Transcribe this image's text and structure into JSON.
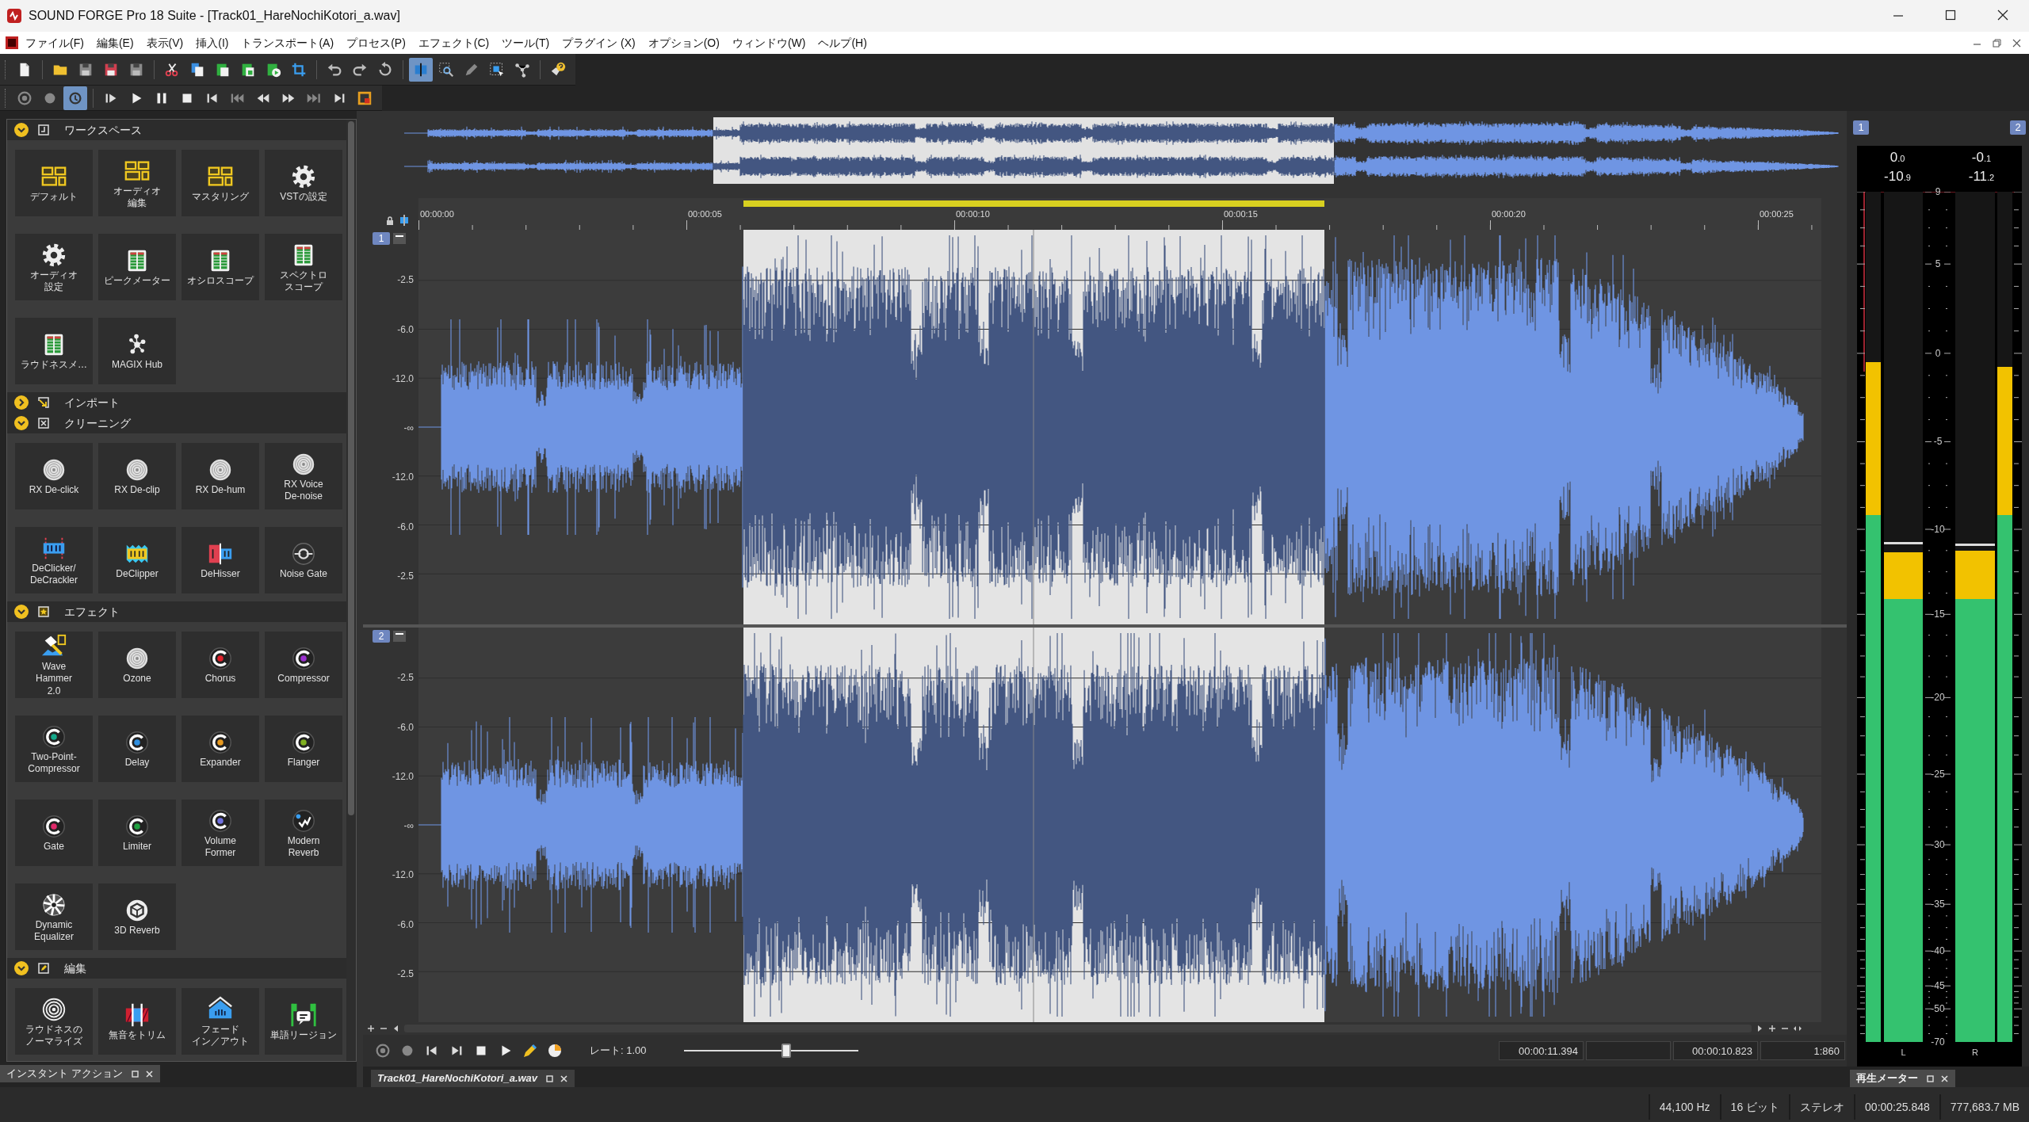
{
  "window": {
    "title": "SOUND FORGE Pro 18 Suite - [Track01_HareNochiKotori_a.wav]"
  },
  "menu": [
    "ファイル(F)",
    "編集(E)",
    "表示(V)",
    "挿入(I)",
    "トランスポート(A)",
    "プロセス(P)",
    "エフェクト(C)",
    "ツール(T)",
    "プラグイン (X)",
    "オプション(O)",
    "ウィンドウ(W)",
    "ヘルプ(H)"
  ],
  "toolbars": [
    [
      {
        "kind": "new",
        "pressed": false
      },
      {
        "kind": "separator"
      },
      {
        "kind": "open",
        "pressed": false
      },
      {
        "kind": "save",
        "pressed": false
      },
      {
        "kind": "save-as",
        "pressed": false
      },
      {
        "kind": "save-all",
        "pressed": false
      },
      {
        "kind": "separator"
      },
      {
        "kind": "cut",
        "pressed": false
      },
      {
        "kind": "copy",
        "pressed": false
      },
      {
        "kind": "paste",
        "pressed": false
      },
      {
        "kind": "paste-mix",
        "pressed": false
      },
      {
        "kind": "paste-new",
        "pressed": false
      },
      {
        "kind": "crop",
        "pressed": false
      },
      {
        "kind": "separator"
      },
      {
        "kind": "undo",
        "pressed": false
      },
      {
        "kind": "redo",
        "pressed": false
      },
      {
        "kind": "repeat",
        "pressed": false
      },
      {
        "kind": "separator"
      },
      {
        "kind": "edit-tool",
        "pressed": true
      },
      {
        "kind": "magnify",
        "pressed": false
      },
      {
        "kind": "pencil",
        "pressed": false
      },
      {
        "kind": "event",
        "pressed": false
      },
      {
        "kind": "nodes",
        "pressed": false
      },
      {
        "kind": "separator"
      },
      {
        "kind": "help",
        "pressed": false
      }
    ],
    [
      {
        "kind": "record",
        "pressed": false
      },
      {
        "kind": "circle",
        "pressed": false
      },
      {
        "kind": "loop",
        "pressed": true
      },
      {
        "kind": "separator"
      },
      {
        "kind": "play-from",
        "pressed": false
      },
      {
        "kind": "play",
        "pressed": false
      },
      {
        "kind": "pause",
        "pressed": false
      },
      {
        "kind": "stop",
        "pressed": false
      },
      {
        "kind": "skip-start",
        "pressed": false
      },
      {
        "kind": "prev-marker",
        "pressed": false
      },
      {
        "kind": "rewind",
        "pressed": false
      },
      {
        "kind": "forward",
        "pressed": false
      },
      {
        "kind": "next-marker",
        "pressed": false
      },
      {
        "kind": "skip-end",
        "pressed": false
      },
      {
        "kind": "sync",
        "pressed": false
      }
    ]
  ],
  "sections": [
    {
      "title": "ワークスペース",
      "kind": "dock",
      "expanded": true,
      "items": [
        {
          "lines": [
            "デフォルト"
          ],
          "kind": "layout"
        },
        {
          "lines": [
            "オーディオ",
            "編集"
          ],
          "kind": "layout"
        },
        {
          "lines": [
            "マスタリング"
          ],
          "kind": "layout"
        },
        {
          "lines": [
            "VSTの設定"
          ],
          "kind": "gear"
        },
        {
          "lines": [
            "オーディオ",
            "設定"
          ],
          "kind": "gear"
        },
        {
          "lines": [
            "ピークメーター"
          ],
          "kind": "meter"
        },
        {
          "lines": [
            "オシロスコープ"
          ],
          "kind": "meter"
        },
        {
          "lines": [
            "スペクトロ",
            "スコープ"
          ],
          "kind": "meter"
        },
        {
          "lines": [
            "ラウドネスメ…"
          ],
          "kind": "meter"
        },
        {
          "lines": [
            "MAGIX Hub"
          ],
          "kind": "hub"
        }
      ]
    },
    {
      "title": "インポート",
      "kind": "import",
      "expanded": false
    },
    {
      "title": "クリーニング",
      "kind": "cross",
      "expanded": true,
      "items": [
        {
          "lines": [
            "RX De-click"
          ],
          "kind": "disc"
        },
        {
          "lines": [
            "RX De-clip"
          ],
          "kind": "disc"
        },
        {
          "lines": [
            "RX De-hum"
          ],
          "kind": "disc"
        },
        {
          "lines": [
            "RX Voice",
            "De-noise"
          ],
          "kind": "disc"
        },
        {
          "lines": [
            "DeClicker/",
            "DeCrackler"
          ],
          "kind": "declick"
        },
        {
          "lines": [
            "DeClipper"
          ],
          "kind": "declip"
        },
        {
          "lines": [
            "DeHisser"
          ],
          "kind": "dehiss"
        },
        {
          "lines": [
            "Noise Gate"
          ],
          "kind": "target"
        }
      ]
    },
    {
      "title": "エフェクト",
      "kind": "star",
      "expanded": true,
      "items": [
        {
          "lines": [
            "Wave",
            "Hammer",
            "2.0"
          ],
          "kind": "hammer"
        },
        {
          "lines": [
            "Ozone"
          ],
          "kind": "disc"
        },
        {
          "lines": [
            "Chorus"
          ],
          "kind": "dial",
          "color": "#e0202a"
        },
        {
          "lines": [
            "Compressor"
          ],
          "kind": "dial",
          "color": "#9b30d0"
        },
        {
          "lines": [
            "Two-Point-",
            "Compressor"
          ],
          "kind": "dial",
          "color": "#14a88a"
        },
        {
          "lines": [
            "Delay"
          ],
          "kind": "dial",
          "color": "#2f8fe0"
        },
        {
          "lines": [
            "Expander"
          ],
          "kind": "dial",
          "color": "#e89a20"
        },
        {
          "lines": [
            "Flanger"
          ],
          "kind": "dial",
          "color": "#7fb020"
        },
        {
          "lines": [
            "Gate"
          ],
          "kind": "dial",
          "color": "#e02a6a"
        },
        {
          "lines": [
            "Limiter"
          ],
          "kind": "dial",
          "color": "#20a040"
        },
        {
          "lines": [
            "Volume",
            "Former"
          ],
          "kind": "dial",
          "color": "#7070e0"
        },
        {
          "lines": [
            "Modern",
            "Reverb"
          ],
          "kind": "reverb"
        },
        {
          "lines": [
            "Dynamic",
            "Equalizer"
          ],
          "kind": "burst"
        },
        {
          "lines": [
            "3D Reverb"
          ],
          "kind": "sphere"
        }
      ]
    },
    {
      "title": "編集",
      "kind": "pencil",
      "expanded": true,
      "items": [
        {
          "lines": [
            "ラウドネスの",
            "ノーマライズ"
          ],
          "kind": "rings"
        },
        {
          "lines": [
            "無音をトリム"
          ],
          "kind": "trim"
        },
        {
          "lines": [
            "フェード",
            "イン／アウト"
          ],
          "kind": "fade"
        },
        {
          "lines": [
            "単語リージョン"
          ],
          "kind": "region"
        }
      ]
    }
  ],
  "instant_action_tab": "インスタント アクション",
  "ruler": [
    "00:00:00",
    "00:00:05",
    "00:00:10",
    "00:00:15",
    "00:00:20",
    "00:00:25"
  ],
  "tracks": [
    {
      "number": "1",
      "scale": [
        "-2.5",
        "-6.0",
        "-12.0",
        "-∞",
        "-12.0",
        "-6.0",
        "-2.5"
      ]
    },
    {
      "number": "2",
      "scale": [
        "-2.5",
        "-6.0",
        "-12.0",
        "-∞",
        "-12.0",
        "-6.0",
        "-2.5"
      ]
    }
  ],
  "transport": {
    "rate": "レート: 1.00",
    "rate_slider": {
      "level": 0.59
    },
    "fields": [
      "00:00:11.394",
      "00:00:10.823",
      "1:860"
    ]
  },
  "file_tab": "Track01_HareNochiKotori_a.wav",
  "meter": {
    "badges": [
      "1",
      "2"
    ],
    "channels": [
      {
        "label": "L",
        "peak": "0$_{.0}$",
        "rms": "-10$_{.9}$"
      },
      {
        "label": "R",
        "peak": "-0$_{.1}$",
        "rms": "-11$_{.2}$"
      }
    ],
    "scale": [
      "9",
      "5",
      "0",
      "-5",
      "-10",
      "-15",
      "-20",
      "-25",
      "-30",
      "-35",
      "-40",
      "-45",
      "-50",
      "-70"
    ],
    "tab": "再生メーター"
  },
  "status_bar": [
    "44,100 Hz",
    "16 ビット",
    "ステレオ",
    "00:00:25.848",
    "777,683.7 MB"
  ]
}
